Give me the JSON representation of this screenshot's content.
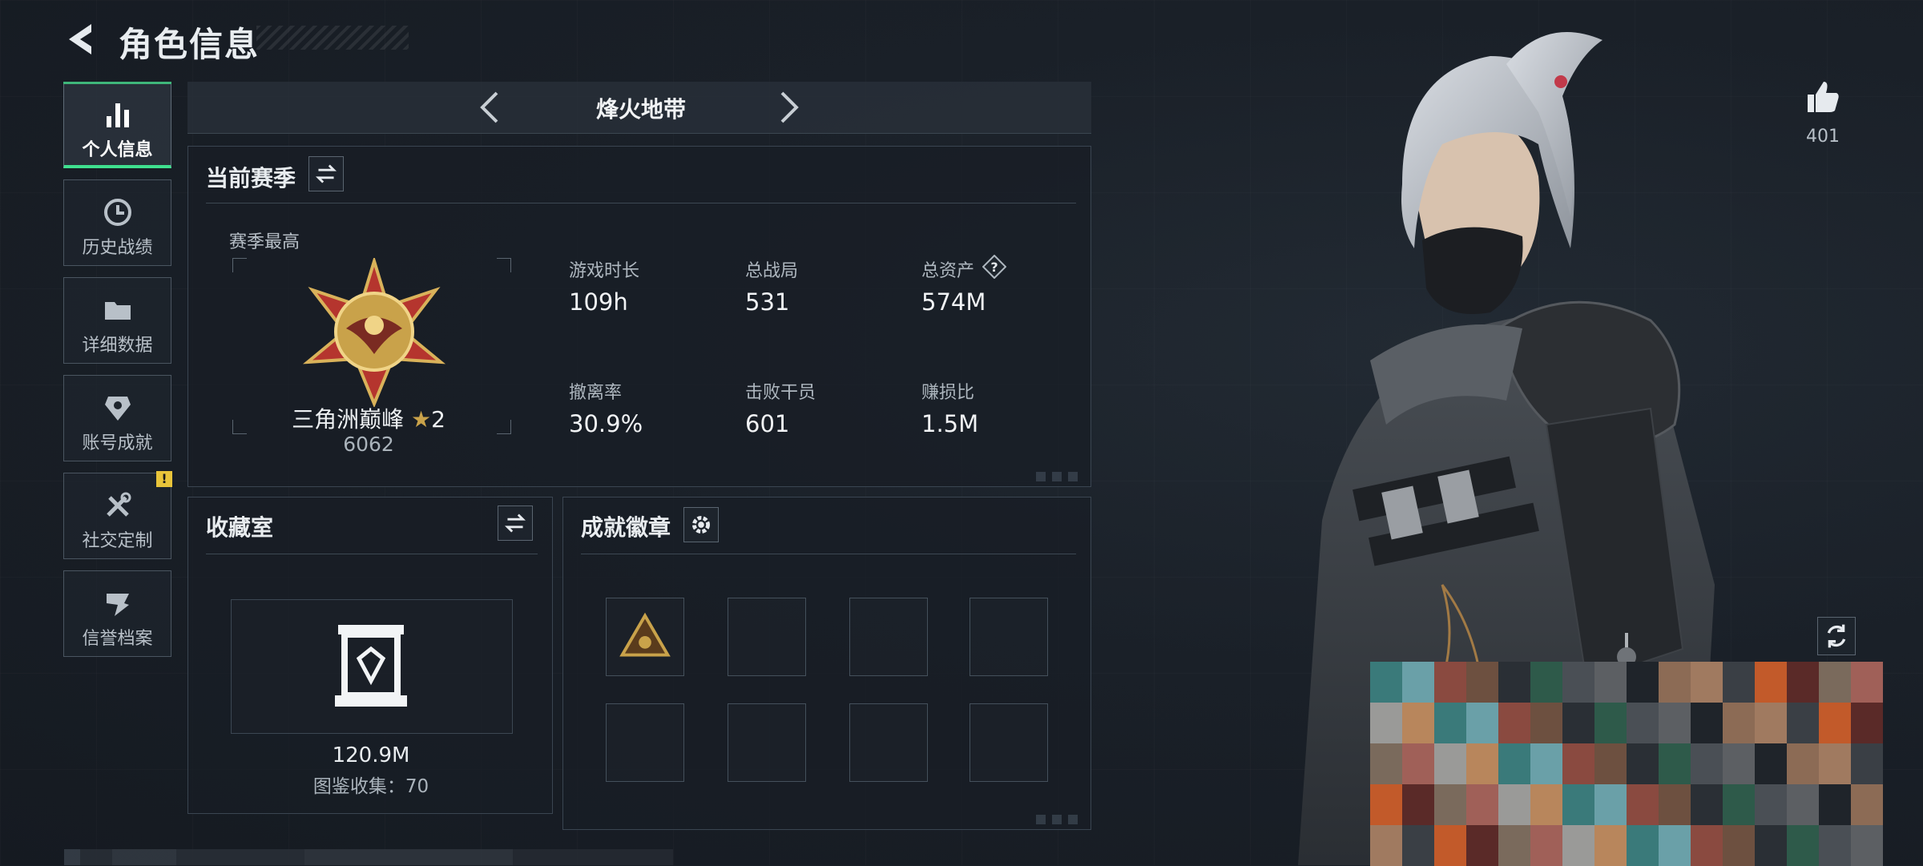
{
  "header": {
    "title": "角色信息"
  },
  "sidebar": {
    "items": [
      {
        "label": "个人信息",
        "icon": "bar-chart-icon",
        "active": true
      },
      {
        "label": "历史战绩",
        "icon": "history-clock-icon"
      },
      {
        "label": "详细数据",
        "icon": "folder-icon"
      },
      {
        "label": "账号成就",
        "icon": "achievement-icon"
      },
      {
        "label": "社交定制",
        "icon": "tools-icon",
        "badge": "!"
      },
      {
        "label": "信誉档案",
        "icon": "reputation-icon"
      }
    ]
  },
  "mode": {
    "title": "烽火地带"
  },
  "season": {
    "title": "当前赛季",
    "best_label": "赛季最高",
    "rank_name": "三角洲巅峰",
    "rank_stars": "2",
    "rank_score": "6062",
    "stats": [
      {
        "label": "游戏时长",
        "value": "109h"
      },
      {
        "label": "总战局",
        "value": "531"
      },
      {
        "label": "总资产",
        "value": "574M",
        "help": "?"
      },
      {
        "label": "撤离率",
        "value": "30.9%"
      },
      {
        "label": "击败干员",
        "value": "601"
      },
      {
        "label": "赚损比",
        "value": "1.5M"
      }
    ]
  },
  "collection": {
    "title": "收藏室",
    "value": "120.9M",
    "count_text": "图鉴收集：70"
  },
  "badges": {
    "title": "成就徽章",
    "slots": 8,
    "filled": 1
  },
  "likes": {
    "count": "401"
  },
  "colors": {
    "accent_green": "#3fe08f",
    "panel_border": "#3a4551",
    "warning_yellow": "#e8c43a",
    "gold": "#c9a24a"
  }
}
